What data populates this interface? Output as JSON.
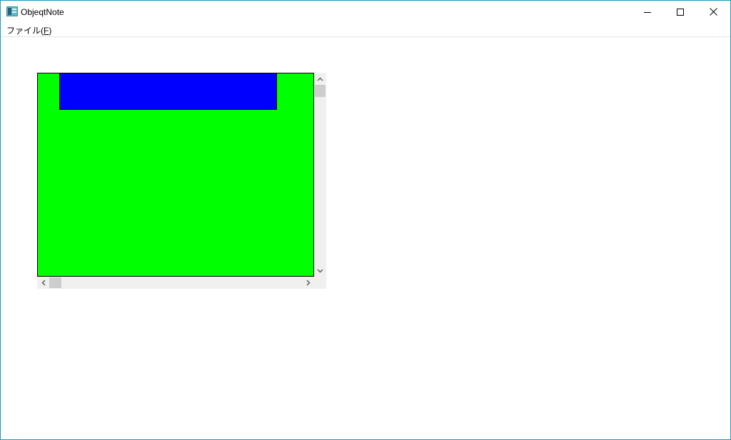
{
  "window": {
    "title": "ObjeqtNote",
    "border_color": "#1b9bc0"
  },
  "icons": {
    "app": "app-icon",
    "minimize": "minimize-icon",
    "maximize": "maximize-icon",
    "close": "close-icon"
  },
  "menubar": {
    "file_label": "ファイル(",
    "file_mnemonic": "F",
    "file_close": ")"
  },
  "canvas": {
    "background_color": "#00ff00",
    "shape_color": "#0000ff"
  }
}
